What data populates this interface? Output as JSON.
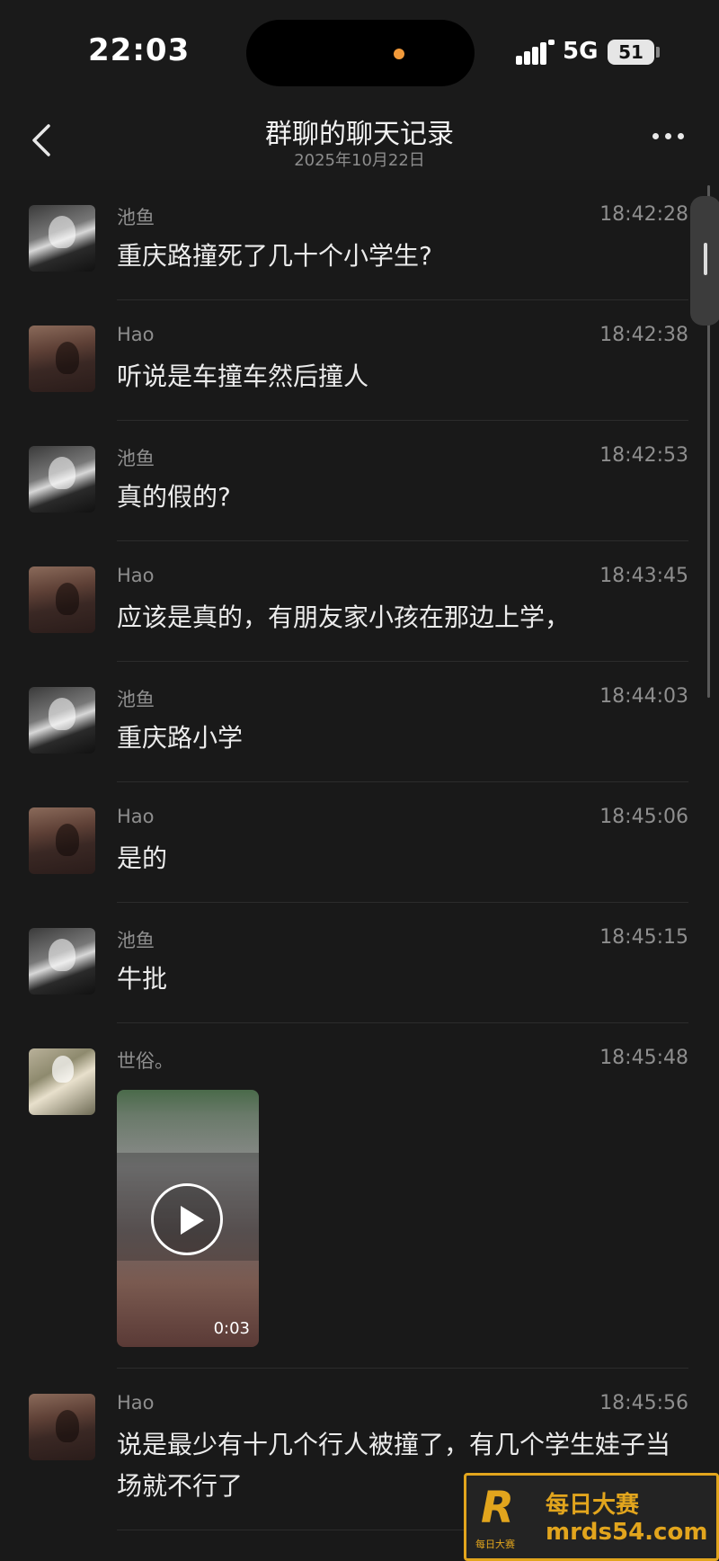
{
  "status_bar": {
    "time": "22:03",
    "network": "5G",
    "battery": "51"
  },
  "header": {
    "title": "群聊的聊天记录",
    "date": "2025年10月22日"
  },
  "messages": [
    {
      "sender": "池鱼",
      "time": "18:42:28",
      "text": "重庆路撞死了几十个小学生?"
    },
    {
      "sender": "Hao",
      "time": "18:42:38",
      "text": "听说是车撞车然后撞人"
    },
    {
      "sender": "池鱼",
      "time": "18:42:53",
      "text": "真的假的?"
    },
    {
      "sender": "Hao",
      "time": "18:43:45",
      "text": "应该是真的，有朋友家小孩在那边上学，"
    },
    {
      "sender": "池鱼",
      "time": "18:44:03",
      "text": "重庆路小学"
    },
    {
      "sender": "Hao",
      "time": "18:45:06",
      "text": "是的"
    },
    {
      "sender": "池鱼",
      "time": "18:45:15",
      "text": "牛批"
    },
    {
      "sender": "世俗。",
      "time": "18:45:48",
      "video_duration": "0:03"
    },
    {
      "sender": "Hao",
      "time": "18:45:56",
      "text": "说是最少有十几个行人被撞了，有几个学生娃子当场就不行了"
    }
  ],
  "watermark": {
    "logo": "R",
    "small": "每日大赛",
    "name": "每日大赛",
    "url": "mrds54.com"
  },
  "colors": {
    "background": "#191919",
    "watermark_gold": "#e2a51d",
    "muted_text": "#8e8e8e"
  }
}
